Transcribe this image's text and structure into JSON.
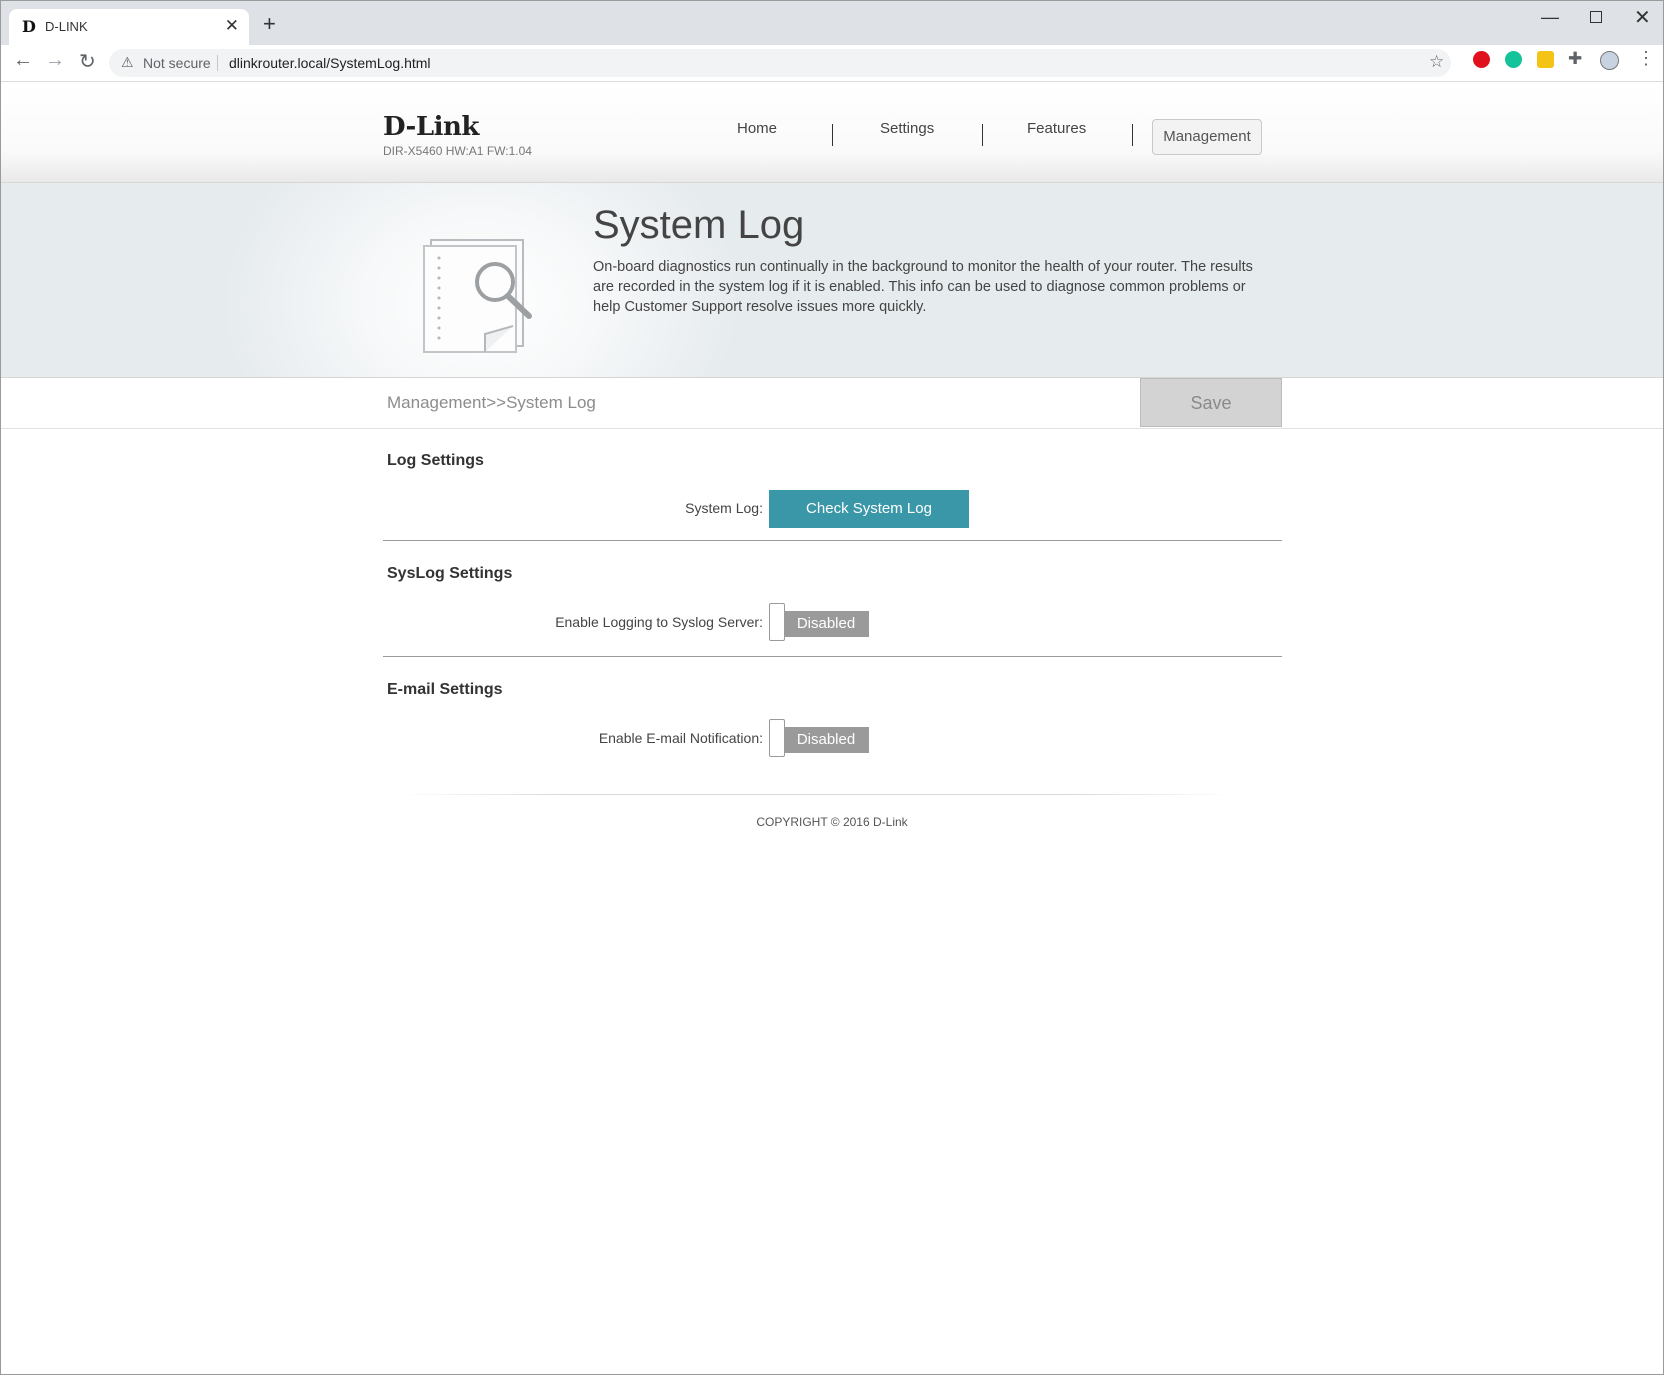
{
  "browser": {
    "tab_title": "D-LINK",
    "tab_favicon": "D",
    "tab_close": "✕",
    "new_tab": "+",
    "security_label": "Not secure",
    "url": "dlinkrouter.local/SystemLog.html"
  },
  "header": {
    "logo": "D-Link",
    "model_info": "DIR-X5460 HW:A1 FW:1.04",
    "nav": {
      "home": "Home",
      "settings": "Settings",
      "features": "Features",
      "management": "Management"
    }
  },
  "banner": {
    "title": "System Log",
    "description": "On-board diagnostics run continually in the background to monitor the health of your router. The results are recorded in the system log if it is enabled. This info can be used to diagnose common problems or help Customer Support resolve issues more quickly."
  },
  "breadcrumb": "Management>>System Log",
  "save_label": "Save",
  "log_settings": {
    "title": "Log Settings",
    "system_log_label": "System Log:",
    "check_button": "Check System Log"
  },
  "syslog_settings": {
    "title": "SysLog Settings",
    "enable_label": "Enable Logging to Syslog Server:",
    "toggle_state": "Disabled"
  },
  "email_settings": {
    "title": "E-mail Settings",
    "enable_label": "Enable E-mail Notification:",
    "toggle_state": "Disabled"
  },
  "footer": {
    "copyright": "COPYRIGHT © 2016 D-Link"
  },
  "colors": {
    "accent_button": "#3a97a8",
    "toggle_disabled": "#9a9a9a",
    "save_disabled": "#d3d3d3"
  }
}
